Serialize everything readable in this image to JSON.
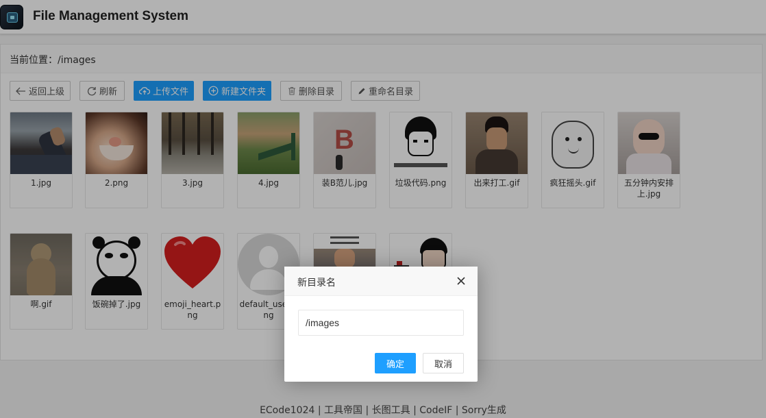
{
  "header": {
    "title": "File Management System"
  },
  "breadcrumb": {
    "label": "当前位置：",
    "path": "/images"
  },
  "toolbar": {
    "back": "返回上级",
    "refresh": "刷新",
    "upload": "上传文件",
    "new_folder": "新建文件夹",
    "delete_dir": "删除目录",
    "rename_dir": "重命名目录"
  },
  "files": [
    {
      "name": "1.jpg"
    },
    {
      "name": "2.png"
    },
    {
      "name": "3.jpg"
    },
    {
      "name": "4.jpg"
    },
    {
      "name": "装B范儿.jpg"
    },
    {
      "name": "垃圾代码.png"
    },
    {
      "name": "出来打工.gif"
    },
    {
      "name": "疯狂摇头.gif"
    },
    {
      "name": "五分钟内安排上.jpg"
    },
    {
      "name": "啊.gif"
    },
    {
      "name": "饭碗掉了.jpg"
    },
    {
      "name": "emoji_heart.png"
    },
    {
      "name": "default_user.png"
    },
    {
      "name": ""
    },
    {
      "name": ""
    }
  ],
  "dialog": {
    "title": "新目录名",
    "input_value": "/images",
    "ok": "确定",
    "cancel": "取消"
  },
  "footer": {
    "links": [
      "ECode1024",
      "工具帝国",
      "长图工具",
      "CodeIF",
      "Sorry生成"
    ],
    "separator": "|"
  },
  "colors": {
    "primary": "#1e9fff",
    "overlay": "rgba(0,0,0,0.3)"
  }
}
